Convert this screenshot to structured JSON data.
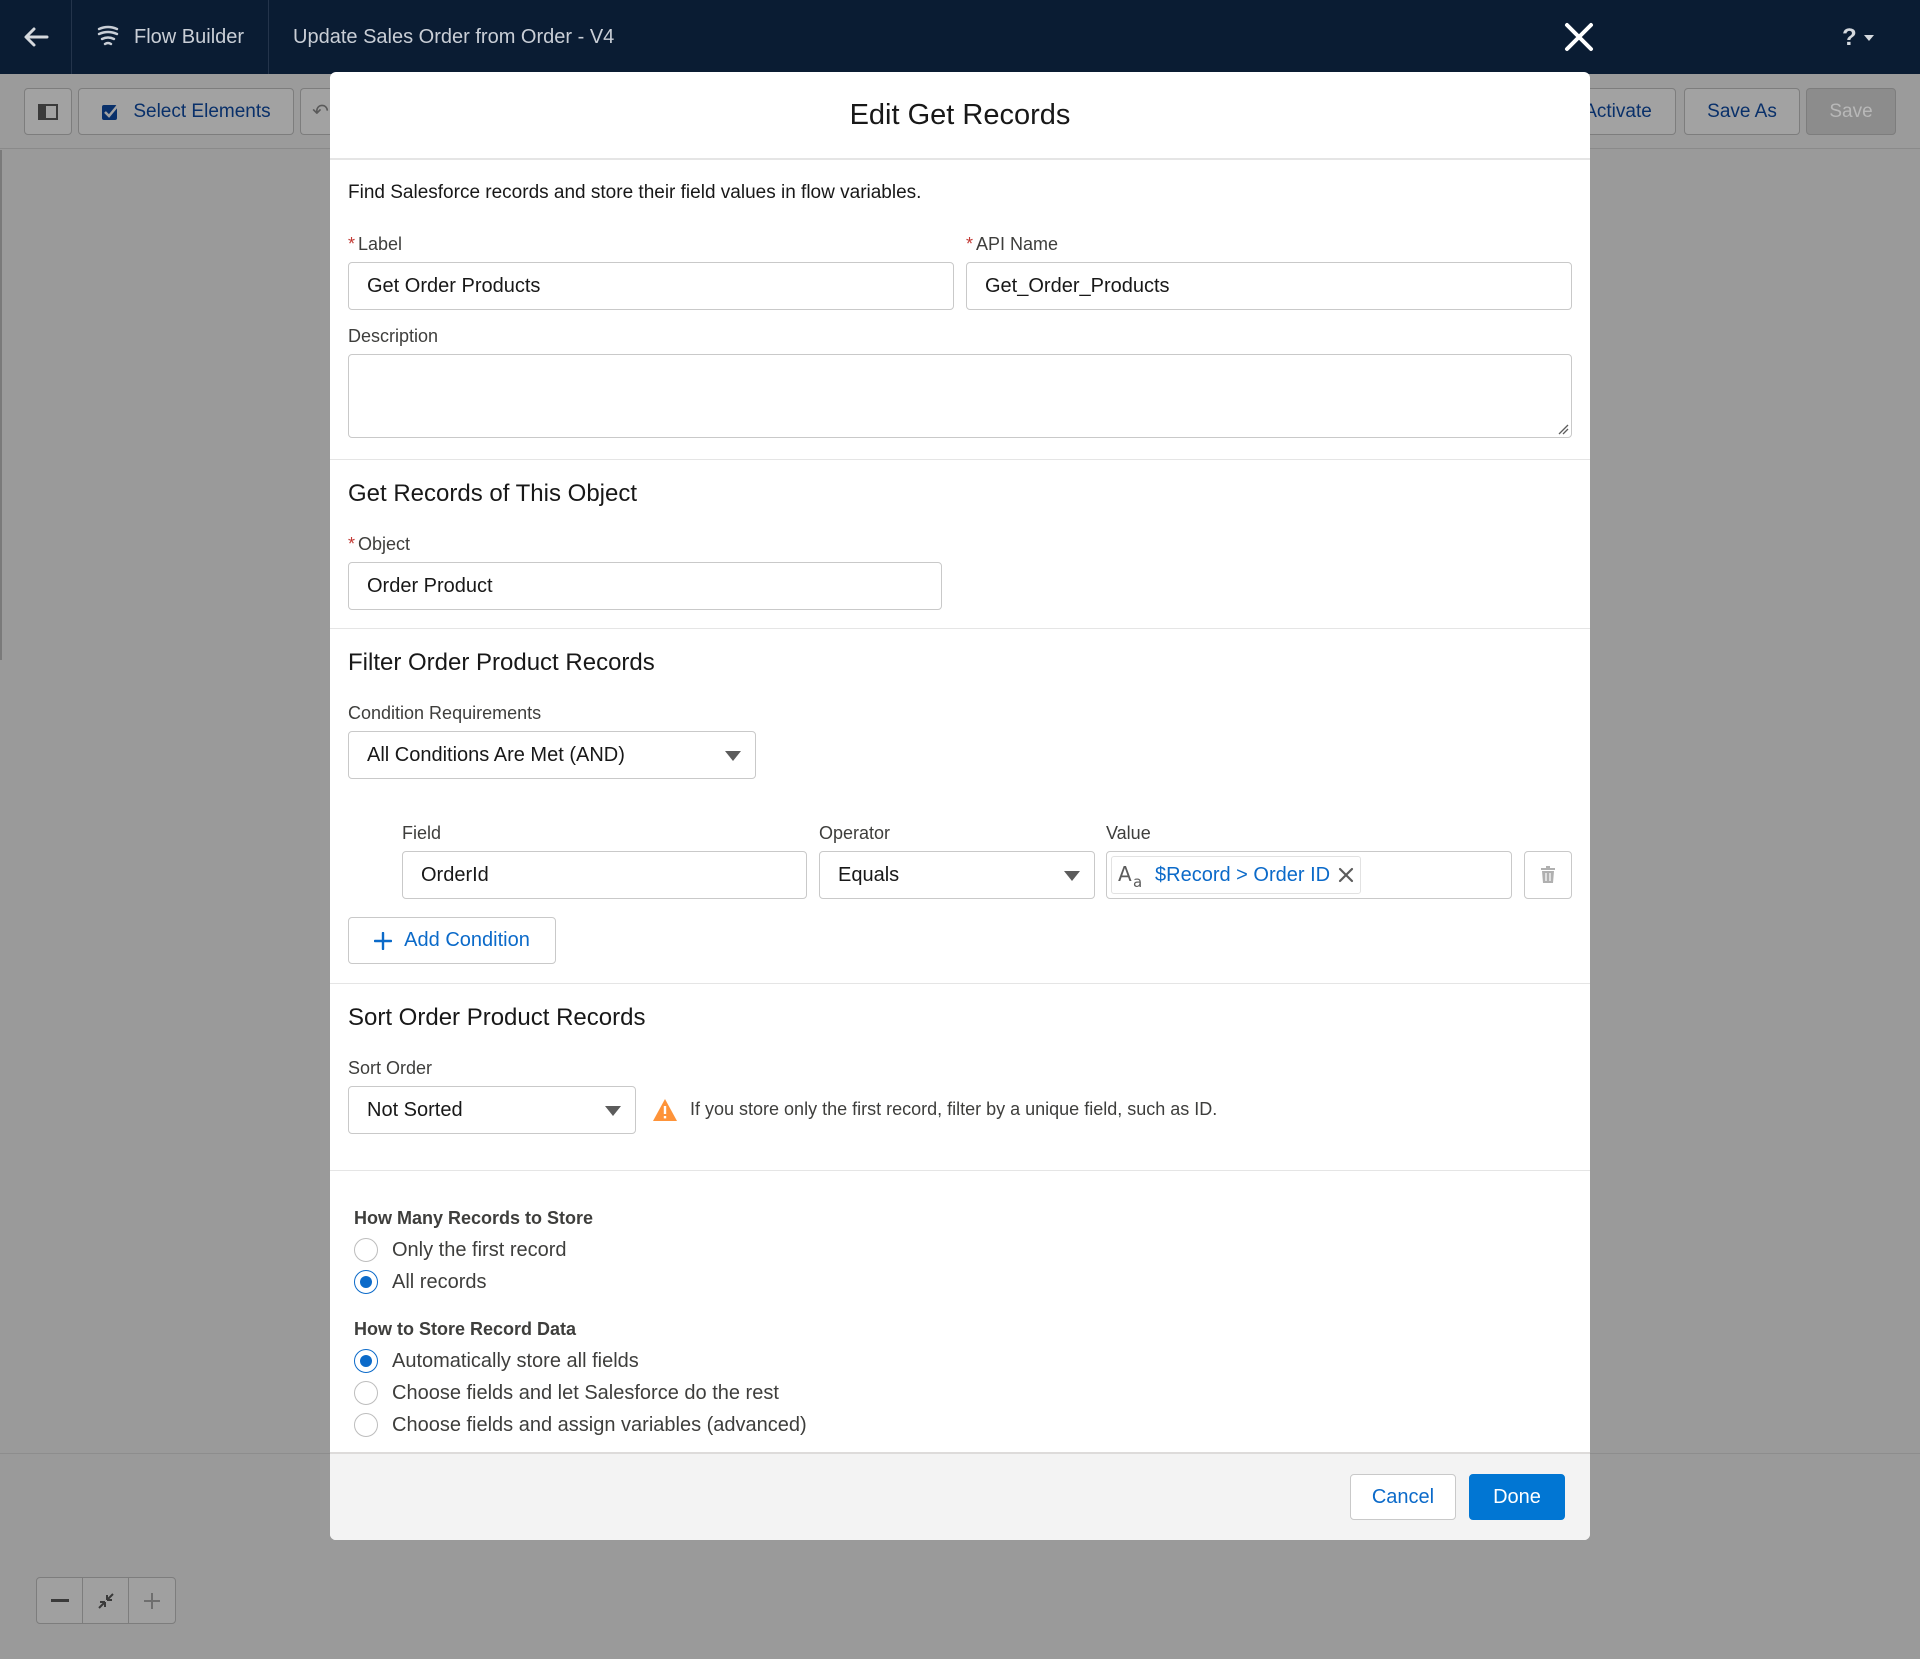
{
  "header": {
    "app_name": "Flow Builder",
    "flow_name": "Update Sales Order from Order - V4",
    "help_label": "?"
  },
  "toolbar": {
    "select_elements": "Select Elements",
    "activate": "Activate",
    "save_as": "Save As",
    "save": "Save"
  },
  "modal": {
    "title": "Edit Get Records",
    "intro": "Find Salesforce records and store their field values in flow variables.",
    "label": {
      "label": "Label",
      "value": "Get Order Products"
    },
    "api_name": {
      "label": "API Name",
      "value": "Get_Order_Products"
    },
    "description": {
      "label": "Description",
      "value": ""
    },
    "object_section": {
      "title": "Get Records of This Object",
      "object_label": "Object",
      "object_value": "Order Product"
    },
    "filter_section": {
      "title": "Filter Order Product Records",
      "condition_label": "Condition Requirements",
      "condition_value": "All Conditions Are Met (AND)",
      "field_header": "Field",
      "operator_header": "Operator",
      "value_header": "Value",
      "conditions": [
        {
          "field": "OrderId",
          "operator": "Equals",
          "value": "$Record > Order ID"
        }
      ],
      "add_condition": "Add Condition"
    },
    "sort_section": {
      "title": "Sort Order Product Records",
      "sort_label": "Sort Order",
      "sort_value": "Not Sorted",
      "warning": "If you store only the first record, filter by a unique field, such as ID."
    },
    "how_many": {
      "title": "How Many Records to Store",
      "options": [
        {
          "label": "Only the first record",
          "checked": false
        },
        {
          "label": "All records",
          "checked": true
        }
      ]
    },
    "how_store": {
      "title": "How to Store Record Data",
      "options": [
        {
          "label": "Automatically store all fields",
          "checked": true
        },
        {
          "label": "Choose fields and let Salesforce do the rest",
          "checked": false
        },
        {
          "label": "Choose fields and assign variables (advanced)",
          "checked": false
        }
      ]
    },
    "footer": {
      "cancel": "Cancel",
      "done": "Done"
    }
  },
  "icons": {
    "back": "back-arrow-icon",
    "flow": "flow-builder-icon",
    "close": "close-icon",
    "help": "help-icon",
    "panel": "panel-toggle-icon",
    "select": "select-checkbox-icon",
    "caret": "chevron-down-icon",
    "text_type": "text-type-icon",
    "remove": "remove-icon",
    "trash": "trash-icon",
    "add": "add-icon",
    "warning": "warning-icon",
    "zoom_out": "zoom-out-icon",
    "fit": "fit-view-icon",
    "zoom_in": "zoom-in-icon"
  },
  "colors": {
    "header_bg": "#0a1c33",
    "brand": "#0176d3",
    "link": "#0b6ac9",
    "warning": "#fe9339",
    "required": "#c23934"
  }
}
